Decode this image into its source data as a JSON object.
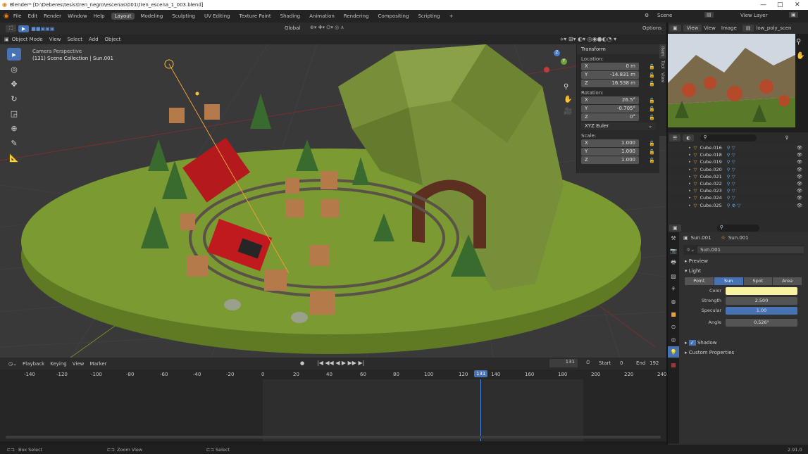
{
  "window": {
    "title": "Blender* [D:\\Deberes\\tesis\\tren_negro\\escenas\\001\\tren_escena_1_003.blend]",
    "minimize": "—",
    "maximize": "□",
    "close": "✕"
  },
  "menu": {
    "items": [
      "File",
      "Edit",
      "Render",
      "Window",
      "Help"
    ],
    "workspaces": [
      "Layout",
      "Modeling",
      "Sculpting",
      "UV Editing",
      "Texture Paint",
      "Shading",
      "Animation",
      "Rendering",
      "Compositing",
      "Scripting"
    ],
    "active_workspace": "Layout",
    "add_tab": "+",
    "scene": "Scene",
    "view_layer": "View Layer"
  },
  "viewport_header": {
    "mode": "Object Mode",
    "items": [
      "View",
      "Select",
      "Add",
      "Object"
    ],
    "transform_orientation": "Global",
    "options": "Options"
  },
  "viewport": {
    "overlay_title": "Camera Perspective",
    "overlay_subtitle": "(131) Scene Collection | Sun.001",
    "tools": [
      "select-box",
      "cursor",
      "move",
      "rotate",
      "scale",
      "transform",
      "annotate",
      "measure"
    ]
  },
  "npanel": {
    "header": "Transform",
    "location_label": "Location:",
    "location": [
      {
        "axis": "X",
        "value": "0 m"
      },
      {
        "axis": "Y",
        "value": "-14.831 m"
      },
      {
        "axis": "Z",
        "value": "16.538 m"
      }
    ],
    "rotation_label": "Rotation:",
    "rotation": [
      {
        "axis": "X",
        "value": "26.5°"
      },
      {
        "axis": "Y",
        "value": "-0.705°"
      },
      {
        "axis": "Z",
        "value": "0°"
      }
    ],
    "rotation_mode": "XYZ Euler",
    "scale_label": "Scale:",
    "scale": [
      {
        "axis": "X",
        "value": "1.000"
      },
      {
        "axis": "Y",
        "value": "1.000"
      },
      {
        "axis": "Z",
        "value": "1.000"
      }
    ],
    "tabs": [
      "Item",
      "Tool",
      "View"
    ]
  },
  "image_editor": {
    "items": [
      "View",
      "View",
      "Image"
    ],
    "image_name": "low_poly_scen"
  },
  "outliner": {
    "rows": [
      "Cube.016",
      "Cube.018",
      "Cube.019",
      "Cube.020",
      "Cube.021",
      "Cube.022",
      "Cube.023",
      "Cube.024",
      "Cube.025"
    ]
  },
  "properties": {
    "object": "Sun.001",
    "data": "Sun.001",
    "datablock": "Sun.001",
    "preview": "Preview",
    "light": "Light",
    "light_types": [
      "Point",
      "Sun",
      "Spot",
      "Area"
    ],
    "active_type": "Sun",
    "color_label": "Color",
    "color_hex": "#f7f3a0",
    "strength_label": "Strength",
    "strength": "2.500",
    "specular_label": "Specular",
    "specular": "1.00",
    "angle_label": "Angle",
    "angle": "0.526°",
    "shadow": "Shadow",
    "custom_props": "Custom Properties"
  },
  "timeline": {
    "items": [
      "Playback",
      "Keying",
      "View",
      "Marker"
    ],
    "current_frame": "131",
    "start_label": "Start",
    "start": "0",
    "end_label": "End",
    "end": "192",
    "ruler": [
      "-140",
      "-120",
      "-100",
      "-80",
      "-60",
      "-40",
      "-20",
      "0",
      "20",
      "40",
      "60",
      "80",
      "100",
      "120",
      "140",
      "160",
      "180",
      "200",
      "220",
      "240"
    ],
    "playhead": "131"
  },
  "statusbar": {
    "left": "Box Select",
    "mid": "Zoom View",
    "right": "Select",
    "version": "2.91.0"
  }
}
